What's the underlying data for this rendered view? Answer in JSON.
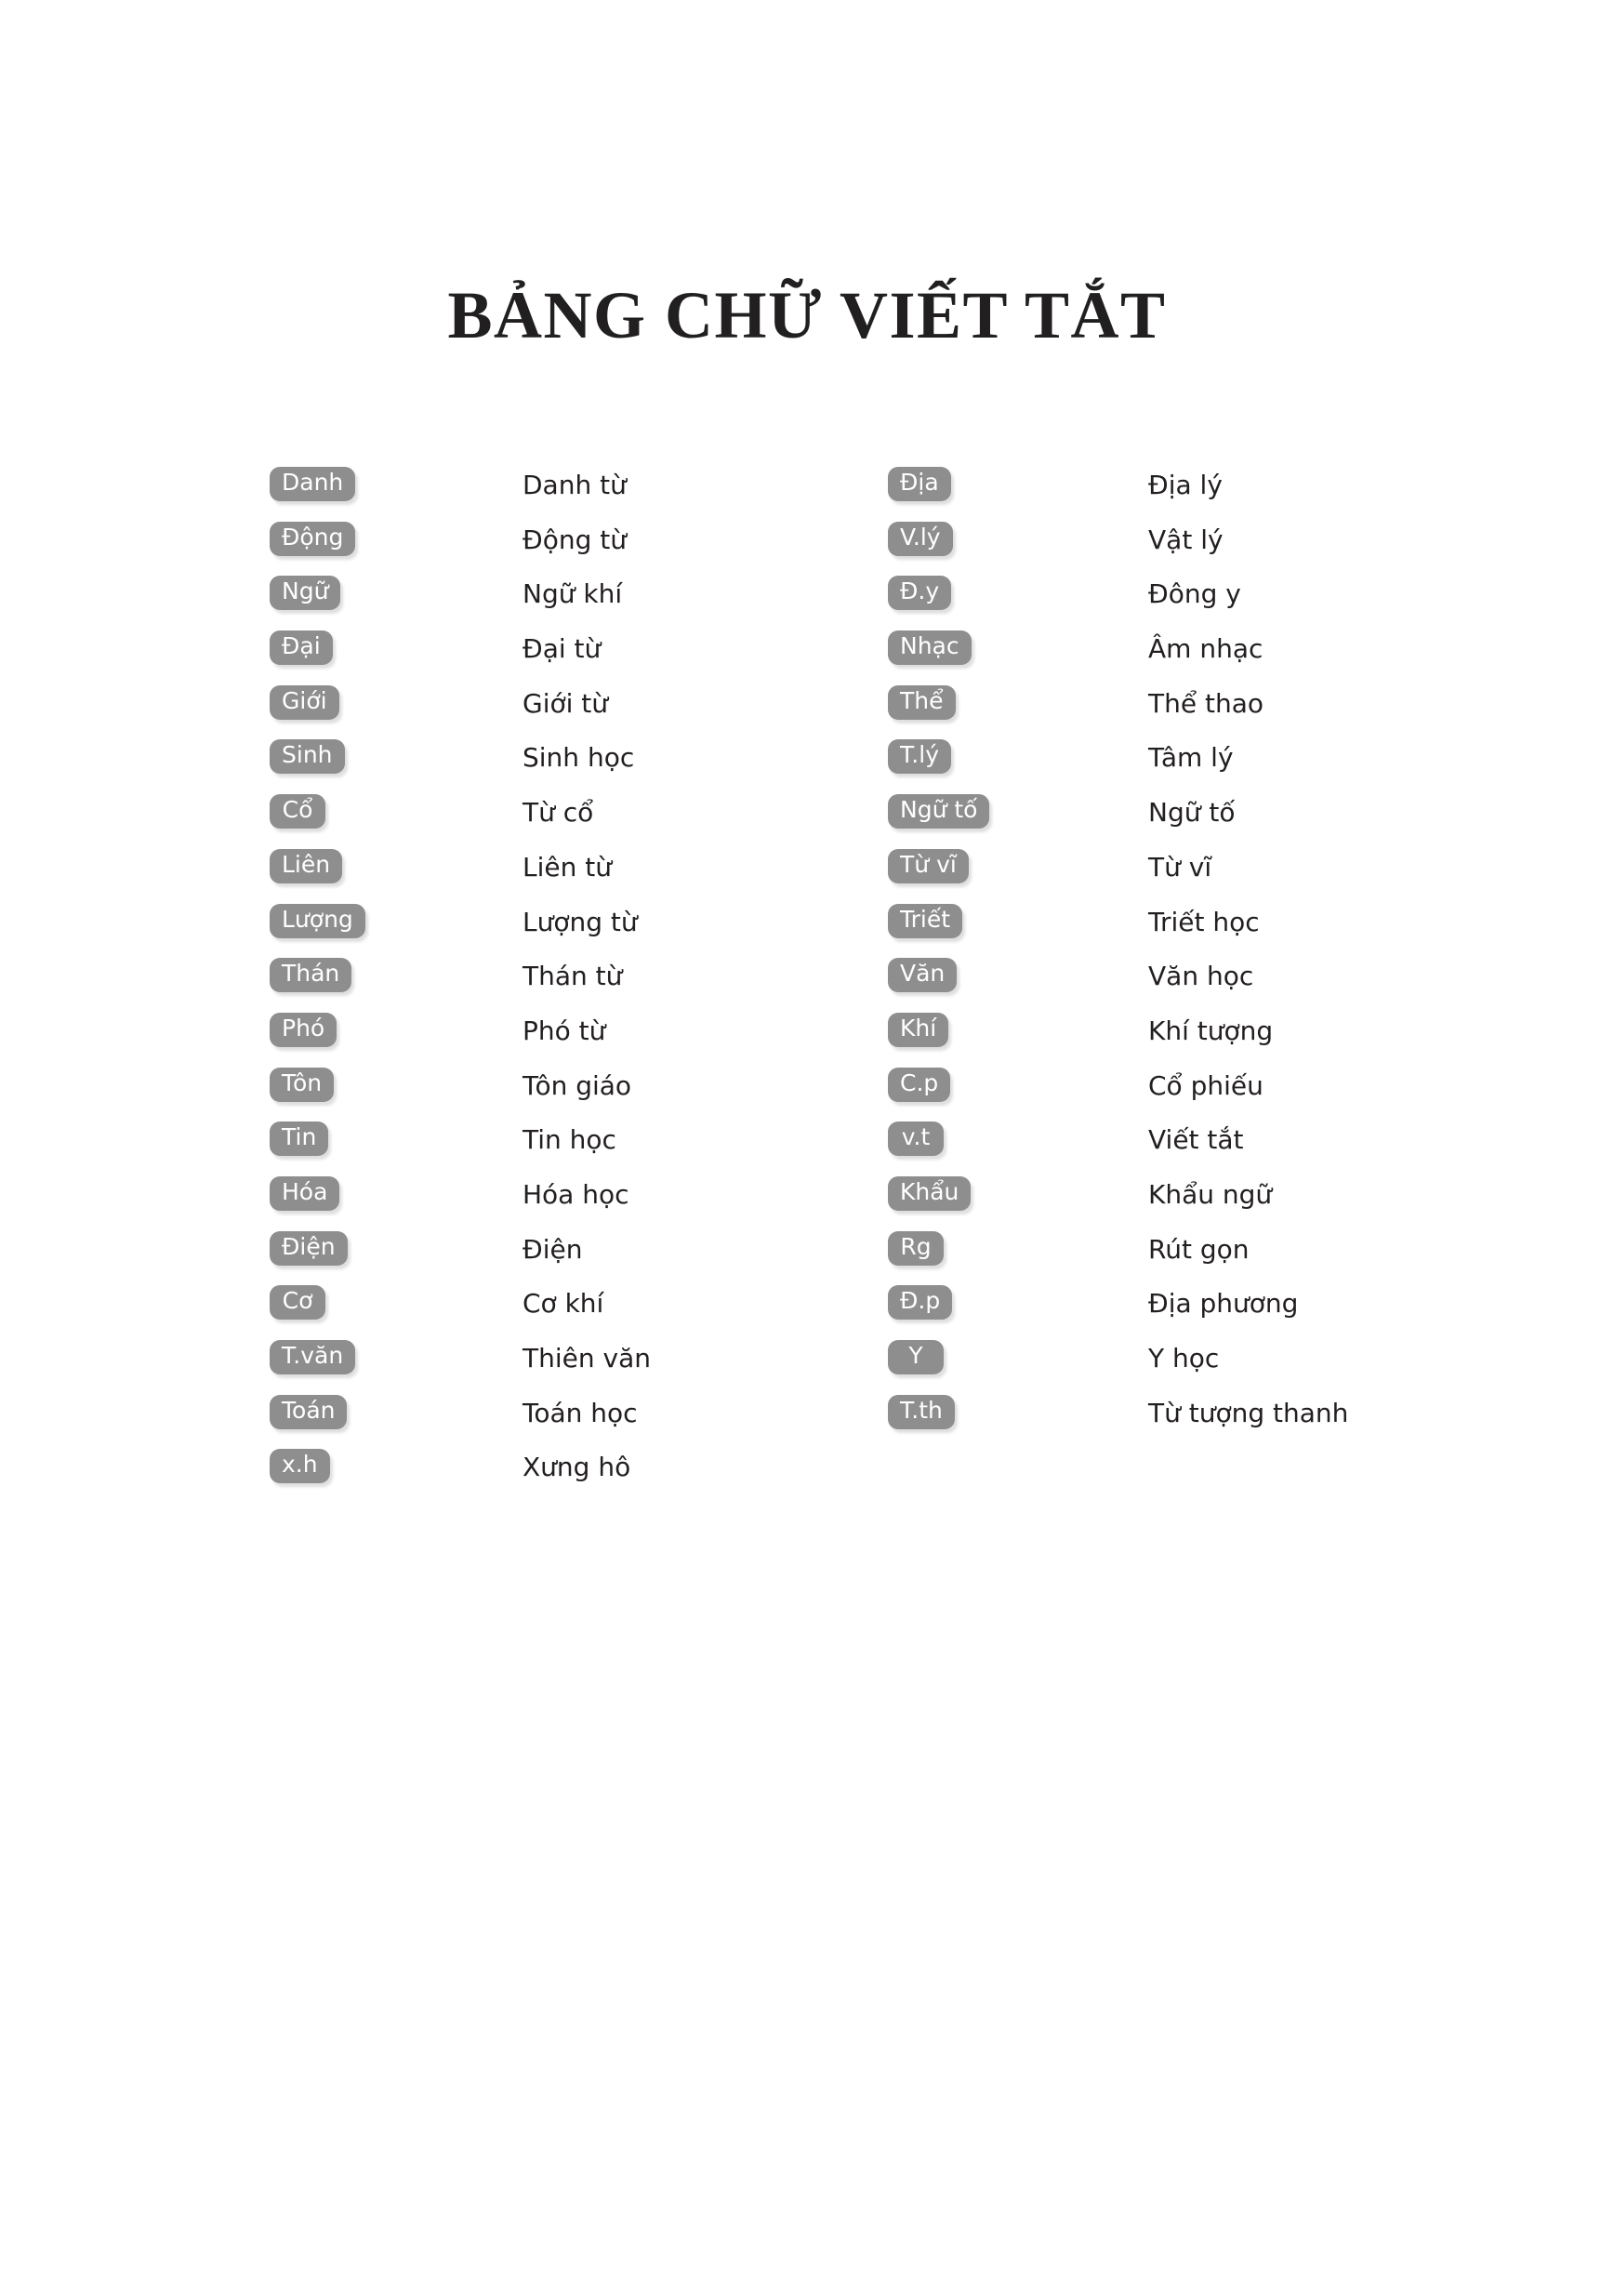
{
  "document": {
    "title": "BẢNG CHỮ VIẾT TẮT",
    "background_color": "#ffffff",
    "badge_color": "#8e8e8e",
    "badge_text_color": "#ffffff",
    "text_color": "#231f20"
  },
  "columns": {
    "left": [
      {
        "abbr": "Danh",
        "meaning": "Danh từ"
      },
      {
        "abbr": "Động",
        "meaning": "Động từ"
      },
      {
        "abbr": "Ngữ",
        "meaning": "Ngữ khí"
      },
      {
        "abbr": "Đại",
        "meaning": "Đại từ"
      },
      {
        "abbr": "Giới",
        "meaning": "Giới từ"
      },
      {
        "abbr": "Sinh",
        "meaning": "Sinh học"
      },
      {
        "abbr": "Cổ",
        "meaning": "Từ cổ"
      },
      {
        "abbr": "Liên",
        "meaning": "Liên từ"
      },
      {
        "abbr": "Lượng",
        "meaning": "Lượng từ"
      },
      {
        "abbr": "Thán",
        "meaning": "Thán từ"
      },
      {
        "abbr": "Phó",
        "meaning": "Phó từ"
      },
      {
        "abbr": "Tôn",
        "meaning": "Tôn giáo"
      },
      {
        "abbr": "Tin",
        "meaning": "Tin học"
      },
      {
        "abbr": "Hóa",
        "meaning": "Hóa học"
      },
      {
        "abbr": "Điện",
        "meaning": "Điện"
      },
      {
        "abbr": "Cơ",
        "meaning": "Cơ khí"
      },
      {
        "abbr": "T.văn",
        "meaning": "Thiên văn"
      },
      {
        "abbr": "Toán",
        "meaning": "Toán học"
      },
      {
        "abbr": "x.h",
        "meaning": "Xưng hô"
      }
    ],
    "right": [
      {
        "abbr": "Địa",
        "meaning": "Địa lý"
      },
      {
        "abbr": "V.lý",
        "meaning": "Vật lý"
      },
      {
        "abbr": "Đ.y",
        "meaning": "Đông y"
      },
      {
        "abbr": "Nhạc",
        "meaning": "Âm nhạc"
      },
      {
        "abbr": "Thể",
        "meaning": "Thể thao"
      },
      {
        "abbr": "T.lý",
        "meaning": "Tâm lý"
      },
      {
        "abbr": "Ngữ tố",
        "meaning": "Ngữ tố"
      },
      {
        "abbr": "Từ vĩ",
        "meaning": "Từ vĩ"
      },
      {
        "abbr": "Triết",
        "meaning": "Triết học"
      },
      {
        "abbr": "Văn",
        "meaning": "Văn học"
      },
      {
        "abbr": "Khí",
        "meaning": "Khí tượng"
      },
      {
        "abbr": "C.p",
        "meaning": "Cổ phiếu"
      },
      {
        "abbr": "v.t",
        "meaning": "Viết tắt"
      },
      {
        "abbr": "Khẩu",
        "meaning": "Khẩu ngữ"
      },
      {
        "abbr": "Rg",
        "meaning": "Rút gọn"
      },
      {
        "abbr": "Đ.p",
        "meaning": "Địa phương"
      },
      {
        "abbr": "Y",
        "meaning": "Y học"
      },
      {
        "abbr": "T.th",
        "meaning": "Từ tượng thanh"
      }
    ]
  }
}
